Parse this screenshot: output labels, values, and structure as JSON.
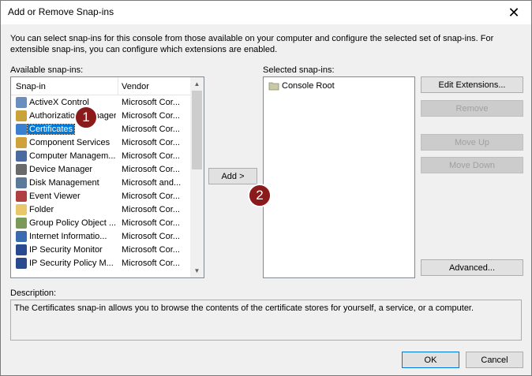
{
  "window": {
    "title": "Add or Remove Snap-ins",
    "close_glyph": "✕"
  },
  "intro_text": "You can select snap-ins for this console from those available on your computer and configure the selected set of snap-ins. For extensible snap-ins, you can configure which extensions are enabled.",
  "available": {
    "label": "Available snap-ins:",
    "columns": {
      "snapin": "Snap-in",
      "vendor": "Vendor"
    },
    "items": [
      {
        "name": "ActiveX Control",
        "vendor": "Microsoft Cor...",
        "icon": "activex-icon"
      },
      {
        "name": "Authorization Manager",
        "vendor": "Microsoft Cor...",
        "icon": "authorization-manager-icon"
      },
      {
        "name": "Certificates",
        "vendor": "Microsoft Cor...",
        "icon": "certificates-icon",
        "selected": true
      },
      {
        "name": "Component Services",
        "vendor": "Microsoft Cor...",
        "icon": "component-services-icon"
      },
      {
        "name": "Computer Managem...",
        "vendor": "Microsoft Cor...",
        "icon": "computer-management-icon"
      },
      {
        "name": "Device Manager",
        "vendor": "Microsoft Cor...",
        "icon": "device-manager-icon"
      },
      {
        "name": "Disk Management",
        "vendor": "Microsoft and...",
        "icon": "disk-management-icon"
      },
      {
        "name": "Event Viewer",
        "vendor": "Microsoft Cor...",
        "icon": "event-viewer-icon"
      },
      {
        "name": "Folder",
        "vendor": "Microsoft Cor...",
        "icon": "folder-icon"
      },
      {
        "name": "Group Policy Object ...",
        "vendor": "Microsoft Cor...",
        "icon": "group-policy-icon"
      },
      {
        "name": "Internet Informatio...",
        "vendor": "Microsoft Cor...",
        "icon": "iis-icon"
      },
      {
        "name": "IP Security Monitor",
        "vendor": "Microsoft Cor...",
        "icon": "ip-security-monitor-icon"
      },
      {
        "name": "IP Security Policy M...",
        "vendor": "Microsoft Cor...",
        "icon": "ip-security-policy-icon"
      }
    ]
  },
  "selected_snapins": {
    "label": "Selected snap-ins:",
    "items": [
      {
        "name": "Console Root",
        "icon": "console-root-folder-icon"
      }
    ]
  },
  "buttons": {
    "add": "Add >",
    "edit_extensions": "Edit Extensions...",
    "remove": "Remove",
    "move_up": "Move Up",
    "move_down": "Move Down",
    "advanced": "Advanced...",
    "ok": "OK",
    "cancel": "Cancel"
  },
  "description": {
    "label": "Description:",
    "text": "The Certificates snap-in allows you to browse the contents of the certificate stores for yourself, a service, or a computer."
  },
  "callouts": {
    "one": "1",
    "two": "2"
  },
  "colors": {
    "selection": "#0078d7",
    "callout": "#8b1a1a"
  }
}
